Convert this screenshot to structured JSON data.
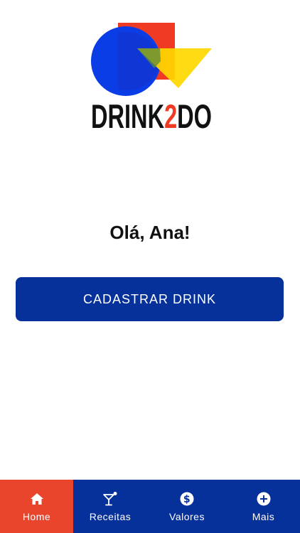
{
  "logo": {
    "text_part1": "DRINK",
    "text_accent": "2",
    "text_part2": "DO",
    "colors": {
      "circle": "#0b3de6",
      "square": "#ef3b24",
      "triangle": "#ffd800",
      "text": "#111111",
      "accent": "#ef3b24"
    }
  },
  "greeting": "Olá, Ana!",
  "primary_button": {
    "label": "CADASTRAR DRINK",
    "color": "#06319b"
  },
  "bottom_nav": {
    "active_color": "#e8452c",
    "background": "#06319b",
    "items": [
      {
        "label": "Home",
        "icon": "home-icon",
        "active": true
      },
      {
        "label": "Receitas",
        "icon": "cocktail-icon",
        "active": false
      },
      {
        "label": "Valores",
        "icon": "dollar-icon",
        "active": false
      },
      {
        "label": "Mais",
        "icon": "plus-icon",
        "active": false
      }
    ]
  }
}
